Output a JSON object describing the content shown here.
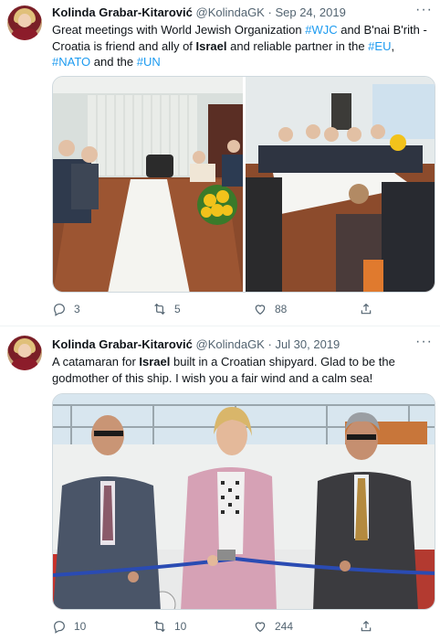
{
  "tweets": [
    {
      "name": "Kolinda Grabar-Kitarović",
      "handle": "@KolindaGK",
      "separator": "·",
      "date": "Sep 24, 2019",
      "more": "···",
      "text_parts": {
        "p1": "Great meetings with World Jewish Organization ",
        "l1": "#WJC",
        "p2": " and B'nai B'rith - Croatia is friend and ally of ",
        "b1": "Israel",
        "p3": " and reliable partner in the ",
        "l2": "#EU",
        "p4": ", ",
        "l3": "#NATO",
        "p5": " and the ",
        "l4": "#UN"
      },
      "replies": "3",
      "retweets": "5",
      "likes": "88"
    },
    {
      "name": "Kolinda Grabar-Kitarović",
      "handle": "@KolindaGK",
      "separator": "·",
      "date": "Jul 30, 2019",
      "more": "···",
      "text_parts": {
        "p1": "A catamaran for ",
        "b1": "Israel",
        "p2": " built in a Croatian shipyard. Glad to be the godmother of this ship. I wish you a fair wind and a calm sea!"
      },
      "replies": "10",
      "retweets": "10",
      "likes": "244"
    }
  ],
  "colors": {
    "link": "#1d9bf0",
    "secondary_text": "#536471",
    "border": "#cfd9de"
  },
  "icons": [
    "reply-icon",
    "retweet-icon",
    "like-icon",
    "share-icon",
    "more-icon"
  ]
}
